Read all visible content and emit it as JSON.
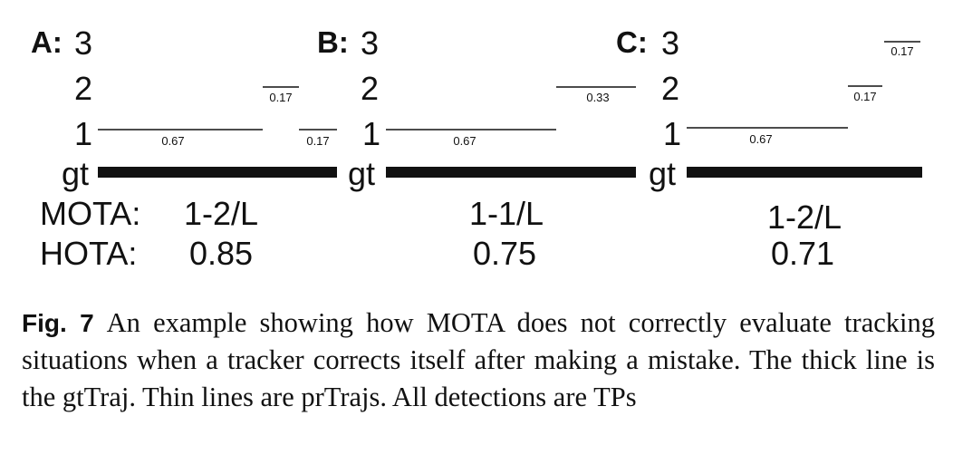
{
  "panels": [
    {
      "label": "A:",
      "row_labels": [
        "3",
        "2",
        "1",
        "gt"
      ],
      "segments": [
        {
          "label": "0.67"
        },
        {
          "label": "0.17"
        },
        {
          "label": "0.17"
        }
      ],
      "mota": "1-2/L",
      "hota": "0.85"
    },
    {
      "label": "B:",
      "row_labels": [
        "3",
        "2",
        "1",
        "gt"
      ],
      "segments": [
        {
          "label": "0.67"
        },
        {
          "label": "0.33"
        }
      ],
      "mota": "1-1/L",
      "hota": "0.75"
    },
    {
      "label": "C:",
      "row_labels": [
        "3",
        "2",
        "1",
        "gt"
      ],
      "segments": [
        {
          "label": "0.67"
        },
        {
          "label": "0.17"
        },
        {
          "label": "0.17"
        }
      ],
      "mota": "1-2/L",
      "hota": "0.71"
    }
  ],
  "metric_labels": {
    "mota": "MOTA:",
    "hota": "HOTA:"
  },
  "caption": {
    "label": "Fig. 7",
    "text": "An example showing how MOTA does not correctly evaluate tracking situations when a tracker corrects itself after making a mistake. The thick line is the gtTraj. Thin lines are prTrajs. All detections are TPs"
  }
}
